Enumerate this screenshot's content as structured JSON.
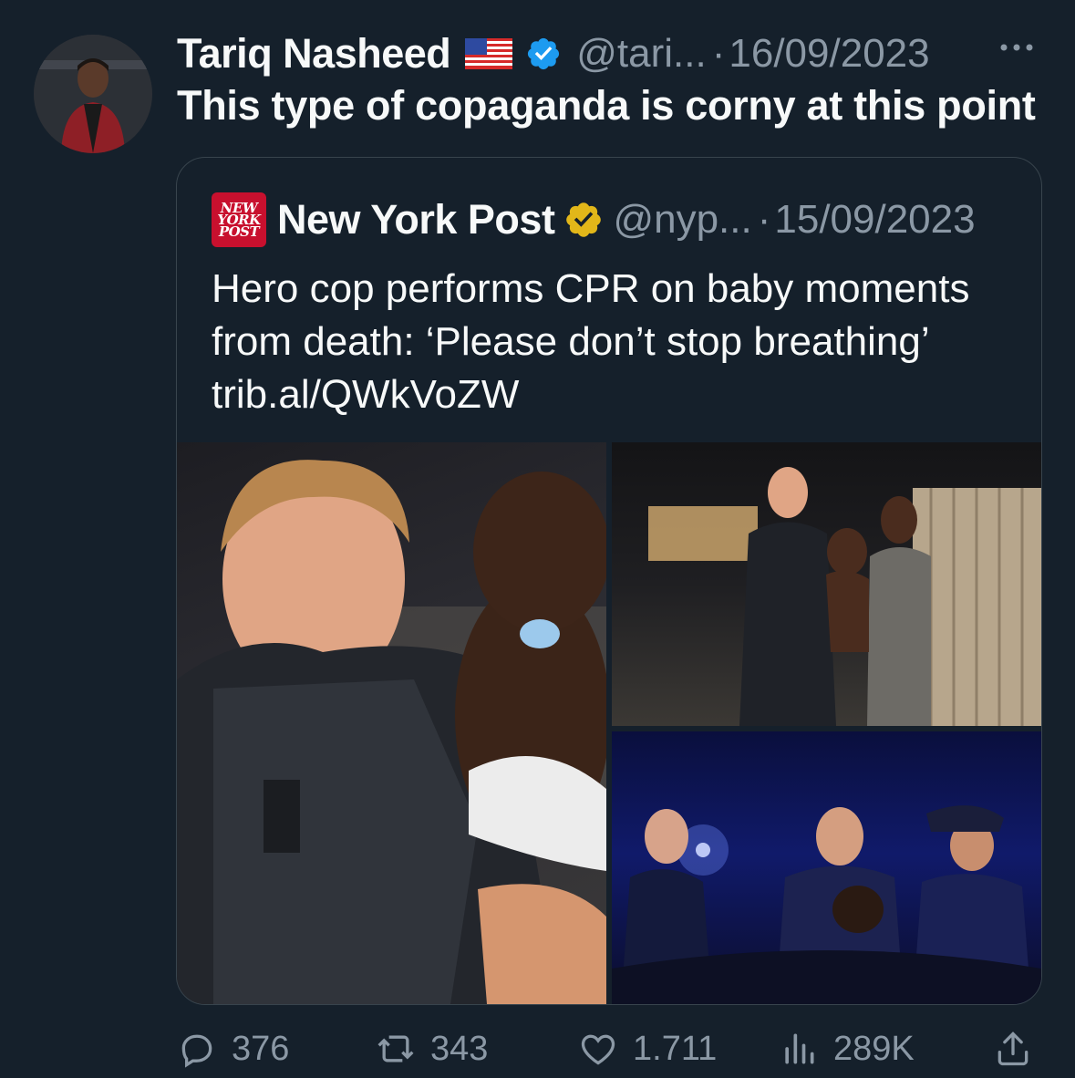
{
  "tweet": {
    "author_name": "Tariq Nasheed",
    "handle": "@tari...",
    "separator": "·",
    "date": "16/09/2023",
    "text": "This type of copaganda is corny at this point"
  },
  "quoted": {
    "logo_lines": [
      "NEW",
      "YORK",
      "POST"
    ],
    "author_name": "New York Post",
    "handle": "@nyp...",
    "separator": "·",
    "date": "15/09/2023",
    "text": "Hero cop performs CPR on baby moments from death: ‘Please don’t stop breathing’",
    "link": "trib.al/QWkVoZW"
  },
  "actions": {
    "replies": "376",
    "retweets": "343",
    "likes": "1.711",
    "views": "289K"
  },
  "colors": {
    "background": "#15202b",
    "muted": "#8b98a5",
    "verified_blue": "#1d9bf0",
    "verified_gold": "#e2b719",
    "nyp_red": "#c8102e"
  },
  "icons": [
    "flag-us-icon",
    "verified-badge-icon",
    "more-icon",
    "gold-verified-badge-icon",
    "reply-icon",
    "retweet-icon",
    "like-icon",
    "views-icon",
    "share-icon"
  ]
}
